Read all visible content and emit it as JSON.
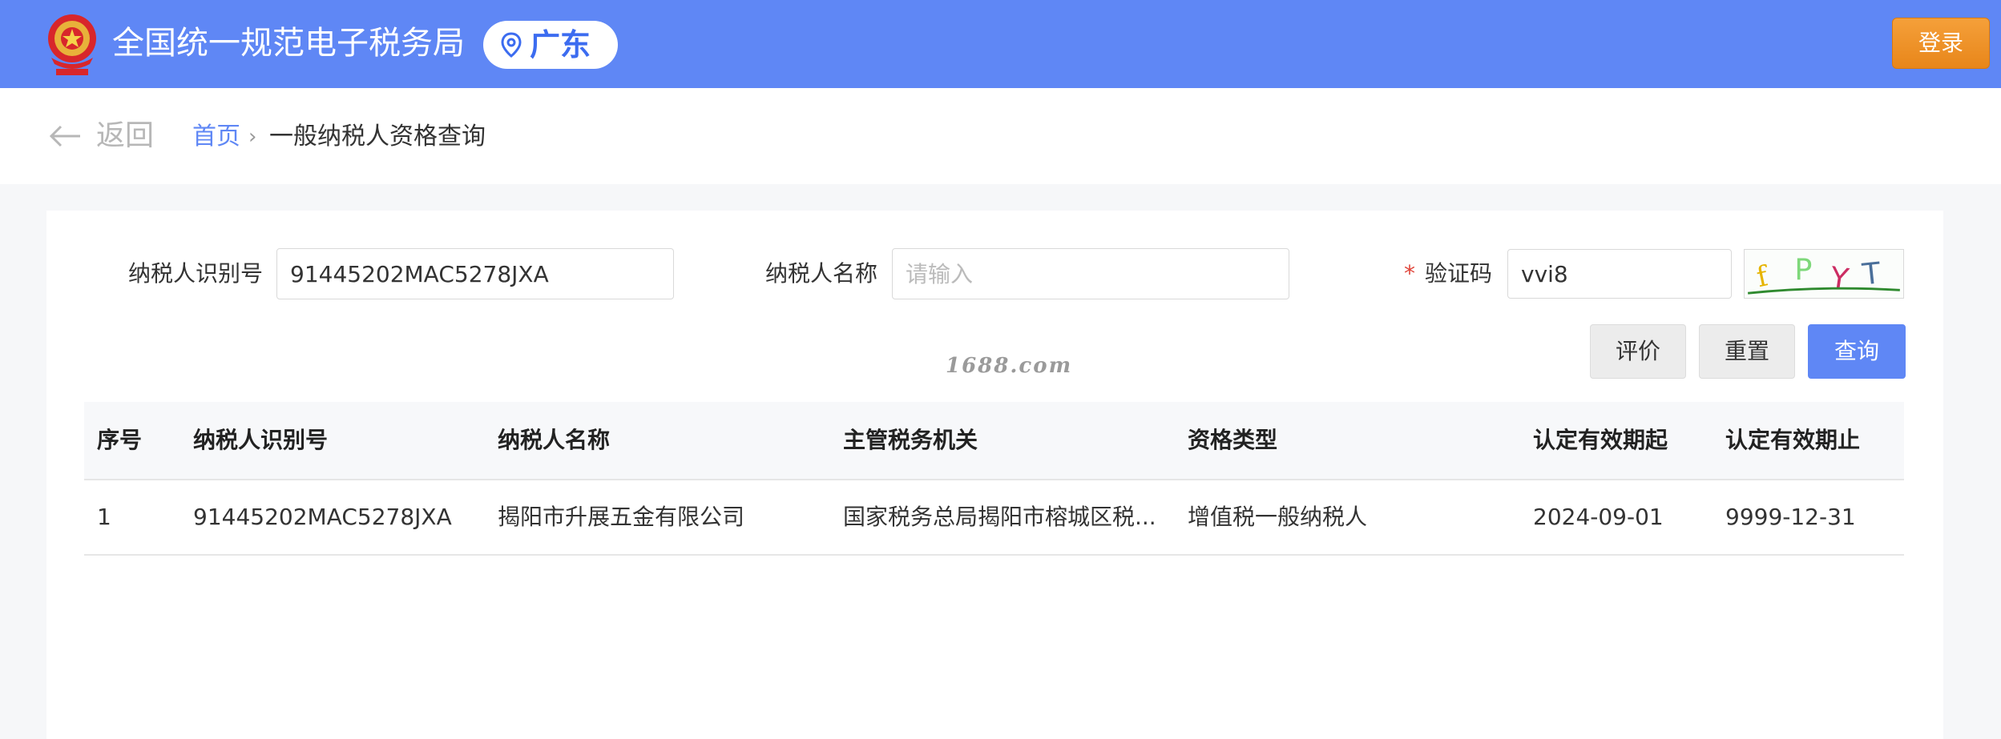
{
  "header": {
    "site_title": "全国统一规范电子税务局",
    "region": "广东",
    "login_label": "登录"
  },
  "nav": {
    "back_label": "返回",
    "breadcrumb_home": "首页",
    "breadcrumb_separator": "›",
    "breadcrumb_current": "一般纳税人资格查询"
  },
  "form": {
    "taxpayer_id_label": "纳税人识别号",
    "taxpayer_id_value": "91445202MAC5278JXA",
    "taxpayer_name_label": "纳税人名称",
    "taxpayer_name_placeholder": "请输入",
    "captcha_required_mark": "*",
    "captcha_label": "验证码",
    "captcha_value": "vvi8",
    "captcha_image_text": "fPYT"
  },
  "buttons": {
    "rate_label": "评价",
    "reset_label": "重置",
    "query_label": "查询"
  },
  "watermark": "1688.com",
  "table": {
    "columns": [
      "序号",
      "纳税人识别号",
      "纳税人名称",
      "主管税务机关",
      "资格类型",
      "认定有效期起",
      "认定有效期止"
    ],
    "rows": [
      [
        "1",
        "91445202MAC5278JXA",
        "揭阳市升展五金有限公司",
        "国家税务总局揭阳市榕城区税...",
        "增值税一般纳税人",
        "2024-09-01",
        "9999-12-31"
      ]
    ]
  },
  "colors": {
    "header_bg": "#5f87f5",
    "login_button": "#eb8c20",
    "primary_button": "#5f87f5",
    "required_mark": "#e0453a"
  }
}
